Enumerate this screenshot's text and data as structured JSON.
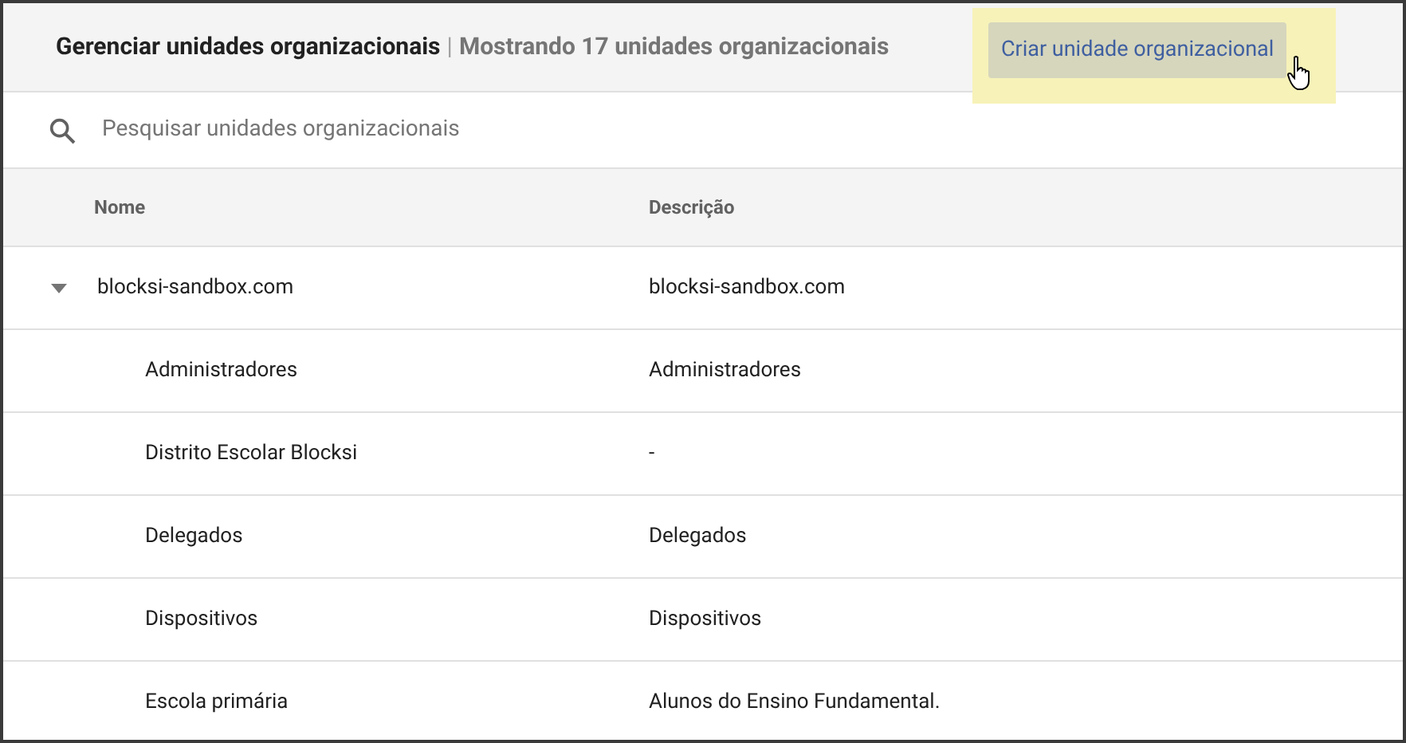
{
  "header": {
    "title": "Gerenciar unidades organizacionais",
    "separator": "|",
    "count": "Mostrando 17 unidades organizacionais",
    "create_button": "Criar unidade organizacional",
    "highlighted": true
  },
  "search": {
    "placeholder": "Pesquisar unidades organizacionais"
  },
  "table": {
    "columns": [
      "Nome",
      "Descrição"
    ],
    "rows": [
      {
        "name": "blocksi-sandbox.com",
        "description": "blocksi-sandbox.com",
        "expanded": true,
        "children": [
          {
            "name": "Administradores",
            "description": "Administradores"
          },
          {
            "name": "Distrito Escolar Blocksi",
            "description": "-"
          },
          {
            "name": "Delegados",
            "description": "Delegados"
          },
          {
            "name": "Dispositivos",
            "description": "Dispositivos"
          },
          {
            "name": "Escola primária",
            "description": "Alunos do Ensino Fundamental."
          }
        ]
      }
    ]
  }
}
